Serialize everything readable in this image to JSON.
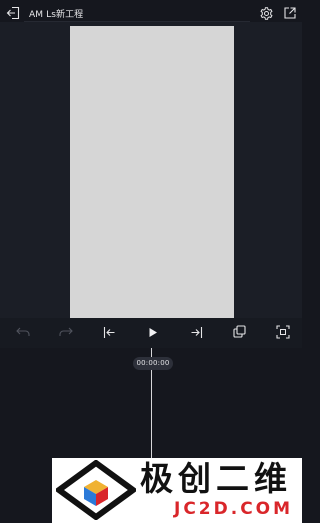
{
  "header": {
    "title": "AM Ls新工程",
    "back_icon": "exit-icon",
    "settings_icon": "gear-icon",
    "export_icon": "export-icon"
  },
  "preview": {
    "canvas_color": "#d6d6d6",
    "background_color": "#1b1e26"
  },
  "toolbar": {
    "items": [
      {
        "icon": "undo-icon",
        "enabled": false
      },
      {
        "icon": "redo-icon",
        "enabled": false
      },
      {
        "icon": "skip-to-start-icon",
        "enabled": true
      },
      {
        "icon": "play-icon",
        "enabled": true
      },
      {
        "icon": "skip-to-end-icon",
        "enabled": true
      },
      {
        "icon": "layers-icon",
        "enabled": true
      },
      {
        "icon": "fullscreen-icon",
        "enabled": true
      }
    ]
  },
  "timeline": {
    "timecode": "00:00:00"
  },
  "watermark": {
    "text": "极创二维",
    "subtext": "JC2D.COM",
    "accent_color": "#d9262a"
  }
}
